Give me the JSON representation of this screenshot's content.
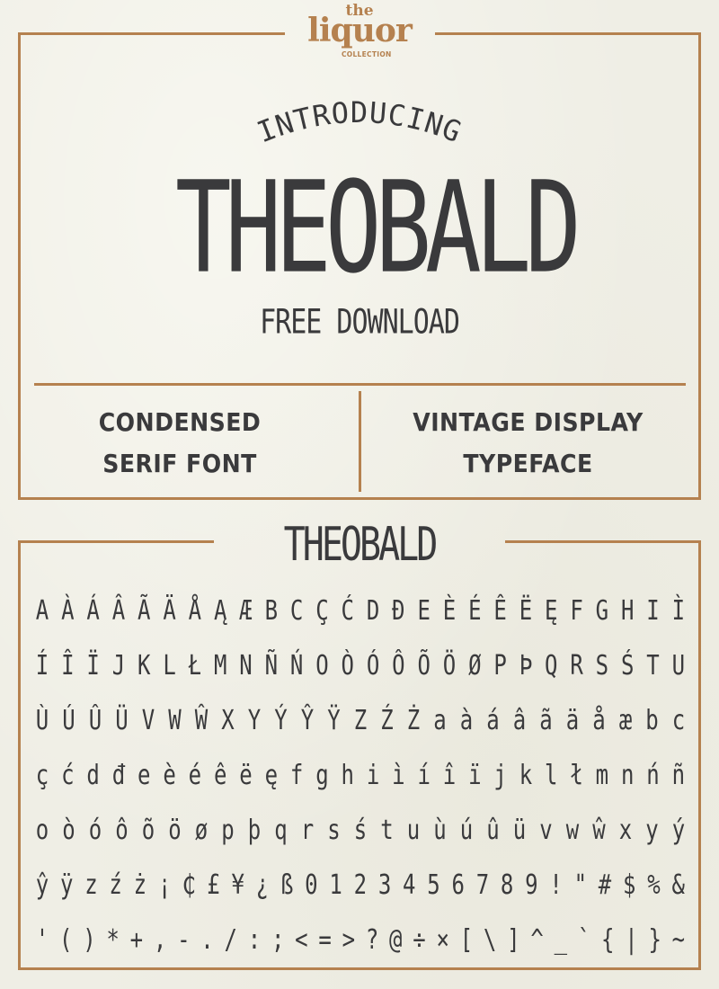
{
  "logo": {
    "line1": "the",
    "line2": "liquor",
    "line3": "COLLECTION"
  },
  "hero": {
    "intro": "INTRODUCING",
    "title": "THEOBALD",
    "subtitle": "FREE DOWNLOAD"
  },
  "features": {
    "left": [
      "CONDENSED",
      "SERIF FONT"
    ],
    "right": [
      "VINTAGE DISPLAY",
      "TYPEFACE"
    ]
  },
  "charmap": {
    "title": "THEOBALD",
    "rows": [
      [
        "A",
        "À",
        "Á",
        "Â",
        "Ã",
        "Ä",
        "Å",
        "Ą",
        "Æ",
        "B",
        "C",
        "Ç",
        "Ć",
        "D",
        "Đ",
        "E",
        "È",
        "É",
        "Ê",
        "Ë",
        "Ę",
        "F",
        "G",
        "H",
        "I",
        "Ì"
      ],
      [
        "Í",
        "Î",
        "Ï",
        "J",
        "K",
        "L",
        "Ł",
        "M",
        "N",
        "Ñ",
        "Ń",
        "O",
        "Ò",
        "Ó",
        "Ô",
        "Õ",
        "Ö",
        "Ø",
        "P",
        "Þ",
        "Q",
        "R",
        "S",
        "Ś",
        "T",
        "U"
      ],
      [
        "Ù",
        "Ú",
        "Û",
        "Ü",
        "V",
        "W",
        "Ŵ",
        "X",
        "Y",
        "Ý",
        "Ŷ",
        "Ÿ",
        "Z",
        "Ź",
        "Ż",
        "a",
        "à",
        "á",
        "â",
        "ã",
        "ä",
        "å",
        "æ",
        "b",
        "c"
      ],
      [
        "ç",
        "ć",
        "d",
        "đ",
        "e",
        "è",
        "é",
        "ê",
        "ë",
        "ę",
        "f",
        "g",
        "h",
        "i",
        "ì",
        "í",
        "î",
        "ï",
        "j",
        "k",
        "l",
        "ł",
        "m",
        "n",
        "ń",
        "ñ"
      ],
      [
        "o",
        "ò",
        "ó",
        "ô",
        "õ",
        "ö",
        "ø",
        "p",
        "þ",
        "q",
        "r",
        "s",
        "ś",
        "t",
        "u",
        "ù",
        "ú",
        "û",
        "ü",
        "v",
        "w",
        "ŵ",
        "x",
        "y",
        "ý"
      ],
      [
        "ŷ",
        "ÿ",
        "z",
        "ź",
        "ż",
        "¡",
        "₵",
        "£",
        "¥",
        "¿",
        "ß",
        "0",
        "1",
        "2",
        "3",
        "4",
        "5",
        "6",
        "7",
        "8",
        "9",
        "!",
        "\"",
        "#",
        "$",
        "%",
        "&"
      ],
      [
        "'",
        "(",
        ")",
        "*",
        "+",
        ",",
        "-",
        ".",
        "/",
        ":",
        ";",
        "<",
        "=",
        ">",
        "?",
        "@",
        "÷",
        "×",
        "[",
        "\\",
        "]",
        "^",
        "_",
        "`",
        "{",
        "|",
        "}",
        "~"
      ]
    ]
  },
  "colors": {
    "accent": "#b5814f",
    "ink": "#3a3a3c",
    "paper": "#efeee5"
  }
}
